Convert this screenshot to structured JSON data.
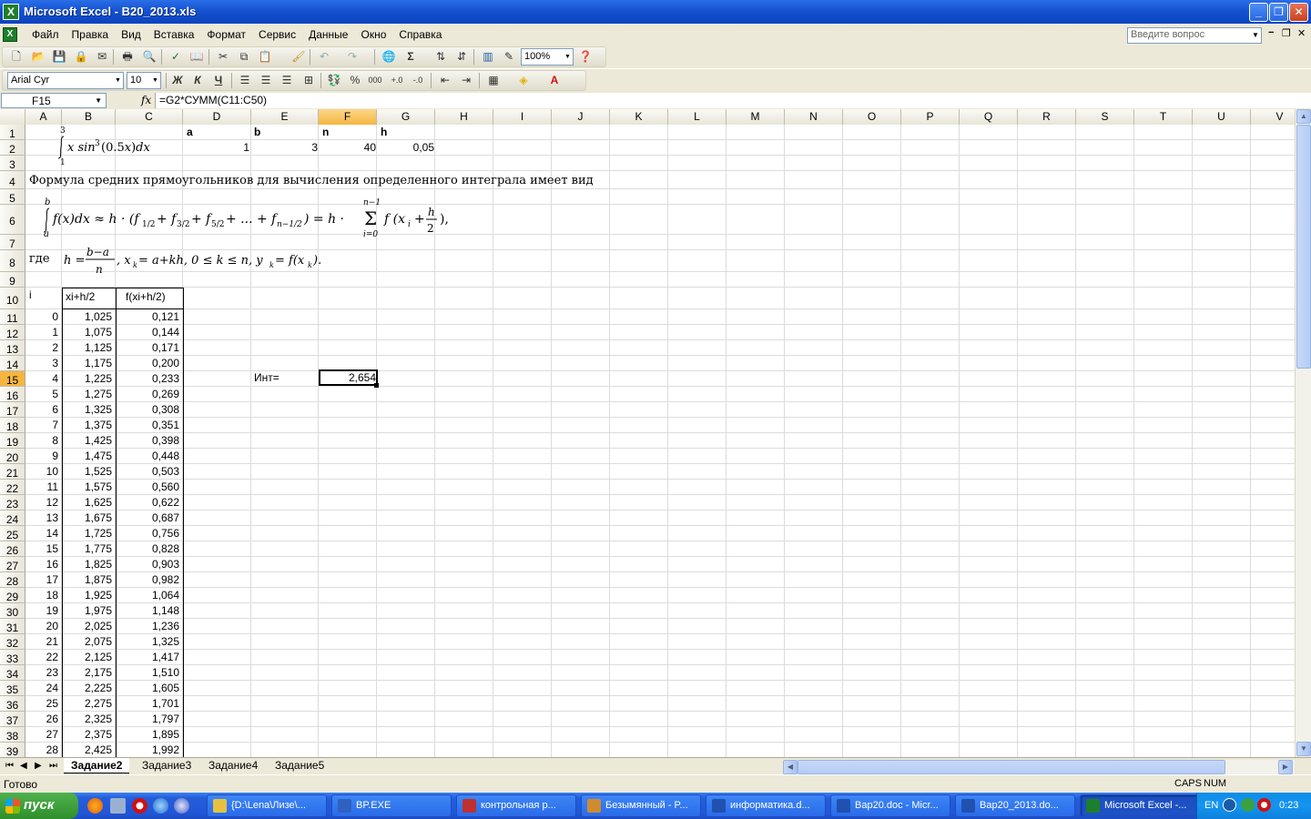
{
  "window": {
    "title": "Microsoft Excel - B20_2013.xls",
    "app_icon": "excel-icon"
  },
  "menu": [
    "Файл",
    "Правка",
    "Вид",
    "Вставка",
    "Формат",
    "Сервис",
    "Данные",
    "Окно",
    "Справка"
  ],
  "help_placeholder": "Введите вопрос",
  "toolbar": {
    "zoom": "100%",
    "font": "Arial Cyr",
    "font_size": "10",
    "bold": "Ж",
    "italic": "К",
    "underline": "Ч",
    "sigma": "Σ"
  },
  "formula_bar": {
    "name_box": "F15",
    "fx": "fx",
    "formula": "=G2*СУММ(C11:C50)"
  },
  "columns": [
    "A",
    "B",
    "C",
    "D",
    "E",
    "F",
    "G",
    "H",
    "I",
    "J",
    "K",
    "L",
    "M",
    "N",
    "O",
    "P",
    "Q",
    "R",
    "S",
    "T",
    "U",
    "V"
  ],
  "selected": {
    "col": "F",
    "row": 15
  },
  "params": {
    "a_label": "a",
    "b_label": "b",
    "n_label": "n",
    "h_label": "h",
    "a": "1",
    "b": "3",
    "n": "40",
    "h": "0,05"
  },
  "integral_limits": {
    "upper": "3",
    "lower": "1"
  },
  "text_row4": "Формула средних прямоугольников для вычисления определенного интеграла имеет вид",
  "text_where": "где",
  "table_headers": [
    "i",
    "xi+h/2",
    "f(xi+h/2)"
  ],
  "table": [
    [
      "0",
      "1,025",
      "0,121"
    ],
    [
      "1",
      "1,075",
      "0,144"
    ],
    [
      "2",
      "1,125",
      "0,171"
    ],
    [
      "3",
      "1,175",
      "0,200"
    ],
    [
      "4",
      "1,225",
      "0,233"
    ],
    [
      "5",
      "1,275",
      "0,269"
    ],
    [
      "6",
      "1,325",
      "0,308"
    ],
    [
      "7",
      "1,375",
      "0,351"
    ],
    [
      "8",
      "1,425",
      "0,398"
    ],
    [
      "9",
      "1,475",
      "0,448"
    ],
    [
      "10",
      "1,525",
      "0,503"
    ],
    [
      "11",
      "1,575",
      "0,560"
    ],
    [
      "12",
      "1,625",
      "0,622"
    ],
    [
      "13",
      "1,675",
      "0,687"
    ],
    [
      "14",
      "1,725",
      "0,756"
    ],
    [
      "15",
      "1,775",
      "0,828"
    ],
    [
      "16",
      "1,825",
      "0,903"
    ],
    [
      "17",
      "1,875",
      "0,982"
    ],
    [
      "18",
      "1,925",
      "1,064"
    ],
    [
      "19",
      "1,975",
      "1,148"
    ],
    [
      "20",
      "2,025",
      "1,236"
    ],
    [
      "21",
      "2,075",
      "1,325"
    ],
    [
      "22",
      "2,125",
      "1,417"
    ],
    [
      "23",
      "2,175",
      "1,510"
    ],
    [
      "24",
      "2,225",
      "1,605"
    ],
    [
      "25",
      "2,275",
      "1,701"
    ],
    [
      "26",
      "2,325",
      "1,797"
    ],
    [
      "27",
      "2,375",
      "1,895"
    ],
    [
      "28",
      "2,425",
      "1,992"
    ]
  ],
  "result": {
    "label": "Инт=",
    "value": "2,654"
  },
  "sheets": [
    "Задание2",
    "Задание3",
    "Задание4",
    "Задание5"
  ],
  "active_sheet": "Задание2",
  "status": {
    "ready": "Готово",
    "caps": "CAPS",
    "num": "NUM"
  },
  "taskbar": {
    "start": "пуск",
    "tasks": [
      "{D:\\Lena\\Лизе\\...",
      "BP.EXE",
      "контрольная р...",
      "Безымянный - P...",
      "информатика.d...",
      "Bap20.doc - Micr...",
      "Bap20_2013.do...",
      "Microsoft Excel -..."
    ],
    "lang": "EN",
    "clock": "0:23"
  }
}
